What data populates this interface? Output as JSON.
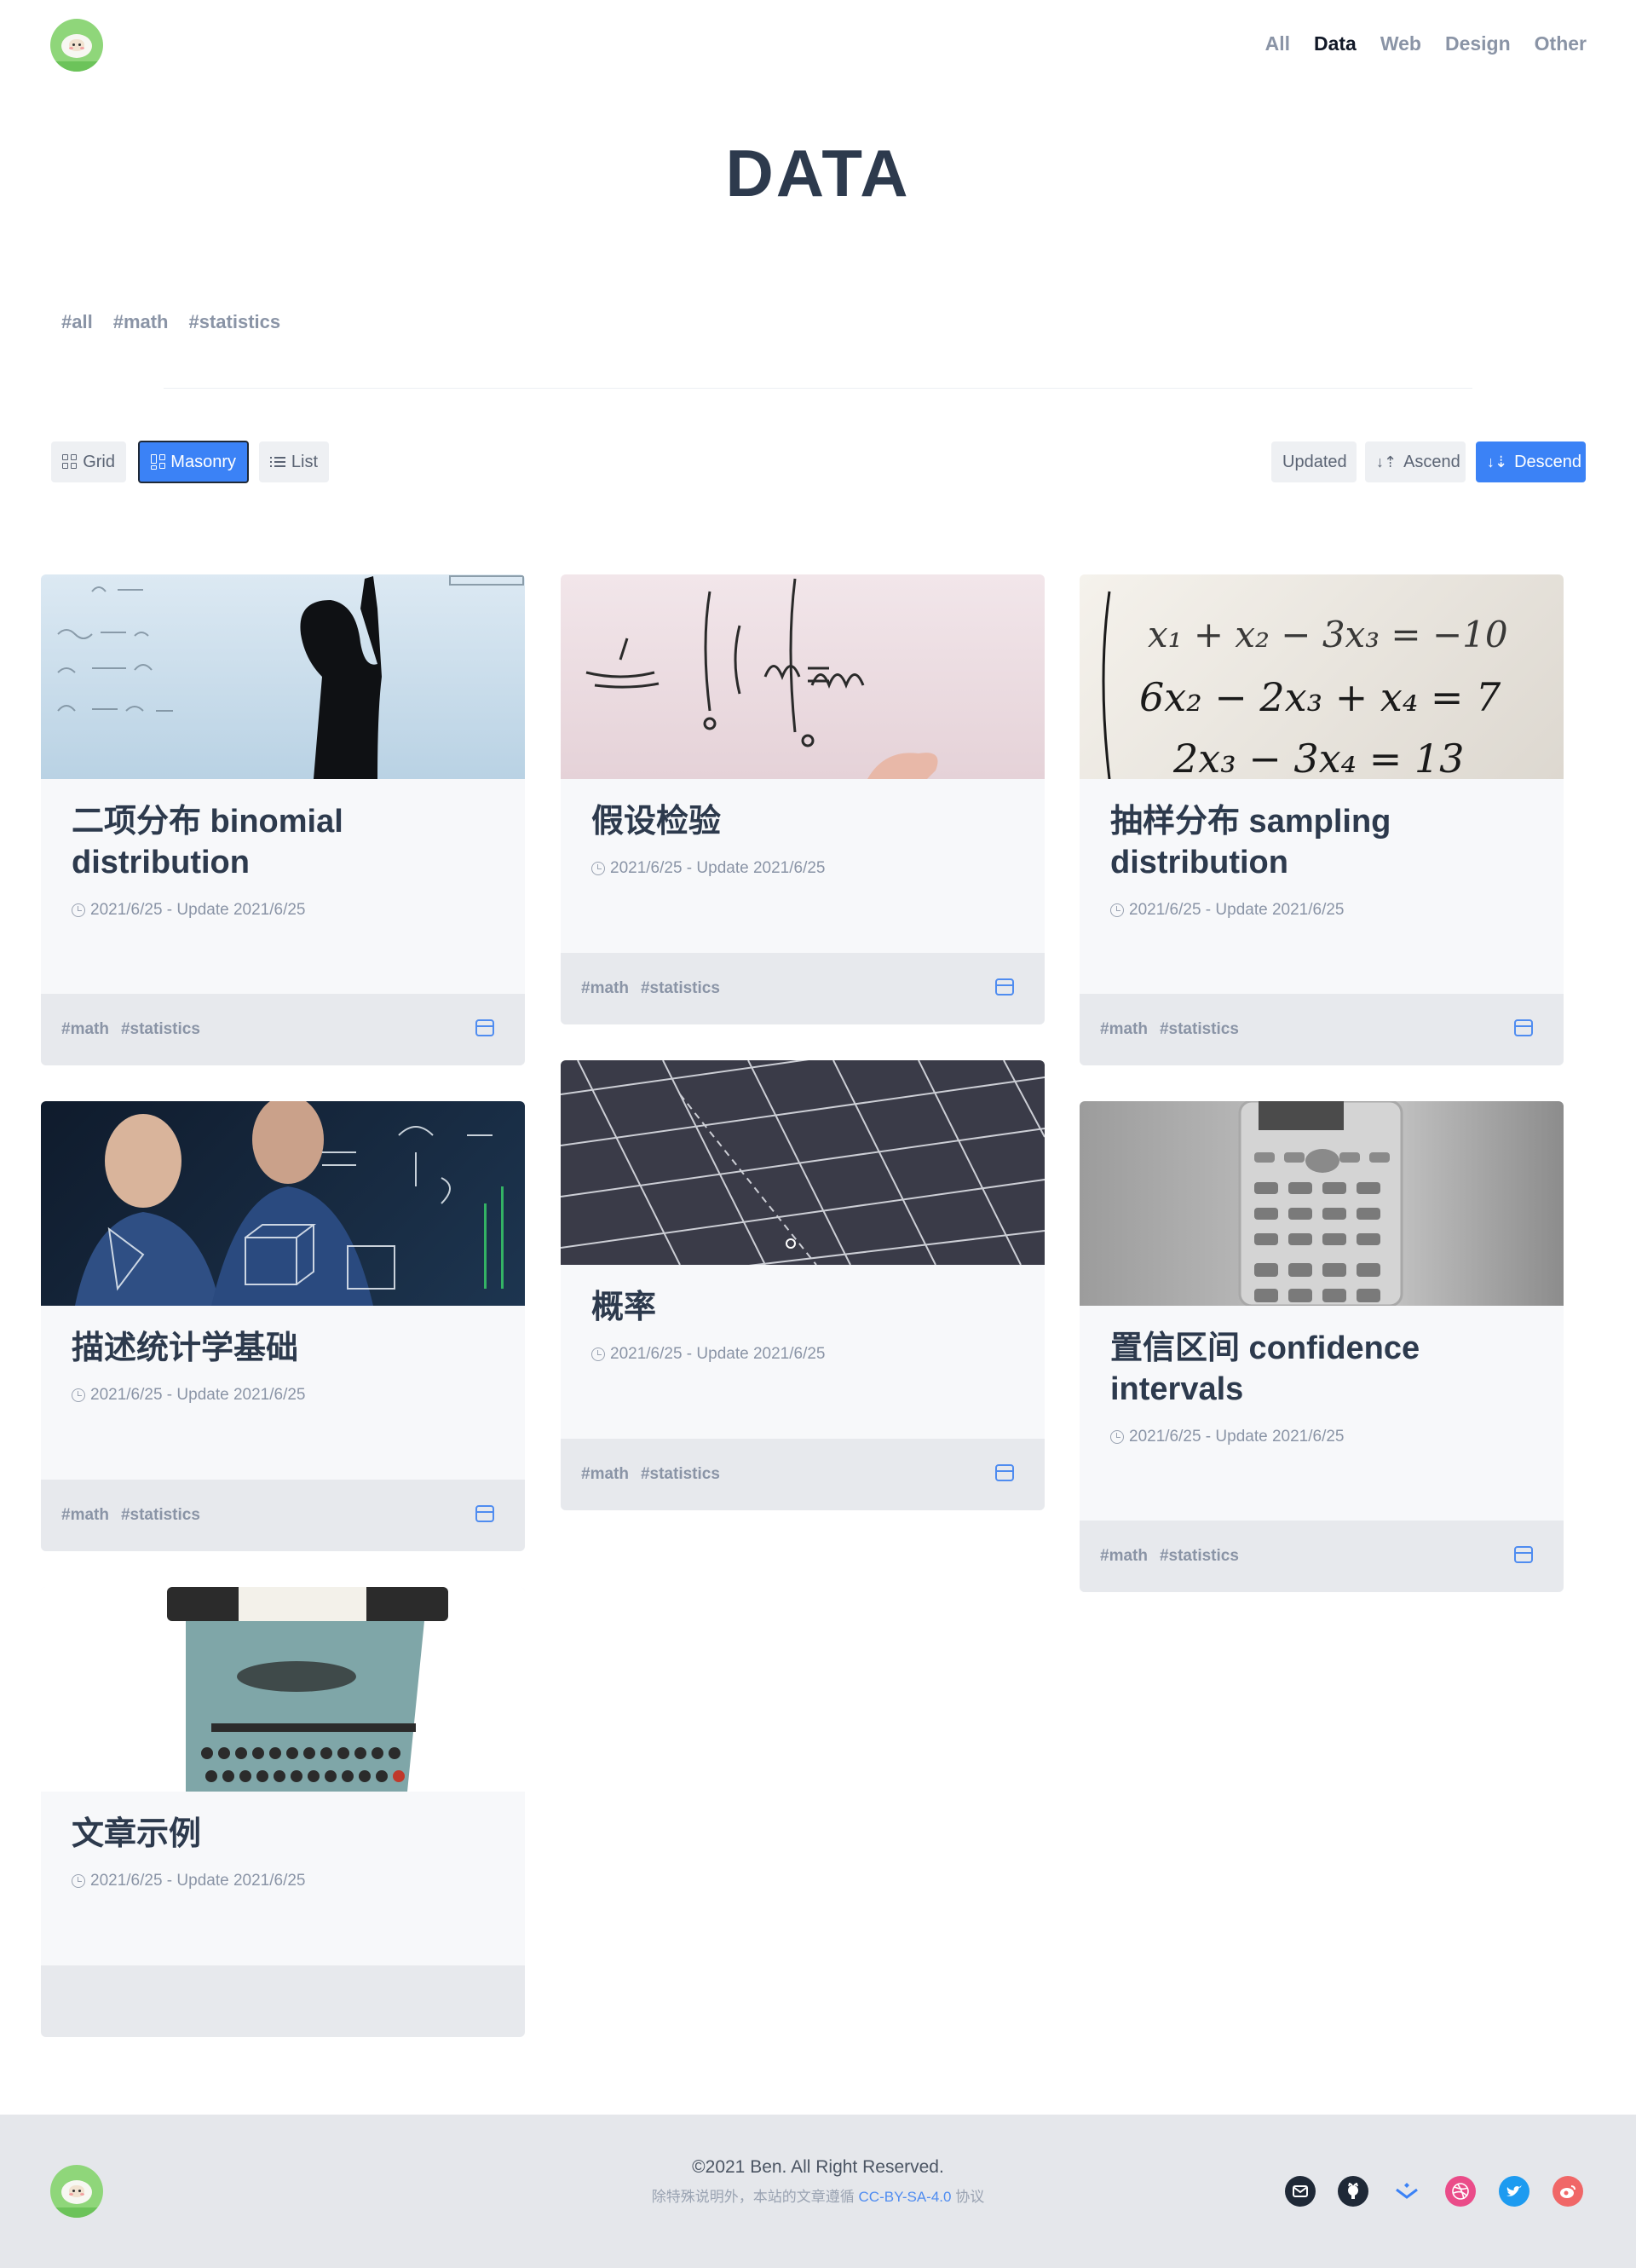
{
  "header": {
    "nav": [
      {
        "label": "All",
        "active": false
      },
      {
        "label": "Data",
        "active": true
      },
      {
        "label": "Web",
        "active": false
      },
      {
        "label": "Design",
        "active": false
      },
      {
        "label": "Other",
        "active": false
      }
    ]
  },
  "page_title": "DATA",
  "tags": [
    "#all",
    "#math",
    "#statistics"
  ],
  "toolbar": {
    "layouts": [
      {
        "label": "Grid",
        "icon": "grid-icon",
        "selected": false
      },
      {
        "label": "Masonry",
        "icon": "masonry-icon",
        "selected": true
      },
      {
        "label": "List",
        "icon": "list-icon",
        "selected": false
      }
    ],
    "sort": [
      {
        "label": "Updated",
        "active": false
      },
      {
        "label": "Ascend",
        "icon": "sort-ascend-icon",
        "active": false
      },
      {
        "label": "Descend",
        "icon": "sort-descend-icon",
        "active": true
      }
    ]
  },
  "cards": [
    {
      "title": "二项分布 binomial distribution",
      "meta": "2021/6/25 - Update 2021/6/25",
      "tags": [
        "#math",
        "#statistics"
      ],
      "image": "woman-whiteboard"
    },
    {
      "title": "假设检验",
      "meta": "2021/6/25 - Update 2021/6/25",
      "tags": [
        "#math",
        "#statistics"
      ],
      "image": "integral-whiteboard"
    },
    {
      "title": "抽样分布 sampling distribution",
      "meta": "2021/6/25 - Update 2021/6/25",
      "tags": [
        "#math",
        "#statistics"
      ],
      "image": "equations-paper"
    },
    {
      "title": "描述统计学基础",
      "meta": "2021/6/25 - Update 2021/6/25",
      "tags": [
        "#math",
        "#statistics"
      ],
      "image": "scientists-glass"
    },
    {
      "title": "概率",
      "meta": "2021/6/25 - Update 2021/6/25",
      "tags": [
        "#math",
        "#statistics"
      ],
      "image": "cutting-mat"
    },
    {
      "title": "置信区间 confidence intervals",
      "meta": "2021/6/25 - Update 2021/6/25",
      "tags": [
        "#math",
        "#statistics"
      ],
      "image": "calculator"
    },
    {
      "title": "文章示例",
      "meta": "2021/6/25 - Update 2021/6/25",
      "tags": [],
      "image": "typewriter"
    }
  ],
  "footer": {
    "copyright": "©2021 Ben. All Right Reserved.",
    "license_prefix": "除特殊说明外，本站的文章遵循 ",
    "license_link": "CC-BY-SA-4.0",
    "license_suffix": " 协议",
    "social": [
      {
        "name": "email-icon",
        "color": "#1f2937"
      },
      {
        "name": "github-icon",
        "color": "#1f2937"
      },
      {
        "name": "juejin-icon",
        "color": "#3b82f6"
      },
      {
        "name": "dribbble-icon",
        "color": "#ea4c89"
      },
      {
        "name": "twitter-icon",
        "color": "#1d9bf0"
      },
      {
        "name": "weibo-icon",
        "color": "#f06767"
      }
    ]
  },
  "colors": {
    "accent": "#3b82f6",
    "title": "#2d3a4d",
    "muted": "#8a94a6"
  }
}
